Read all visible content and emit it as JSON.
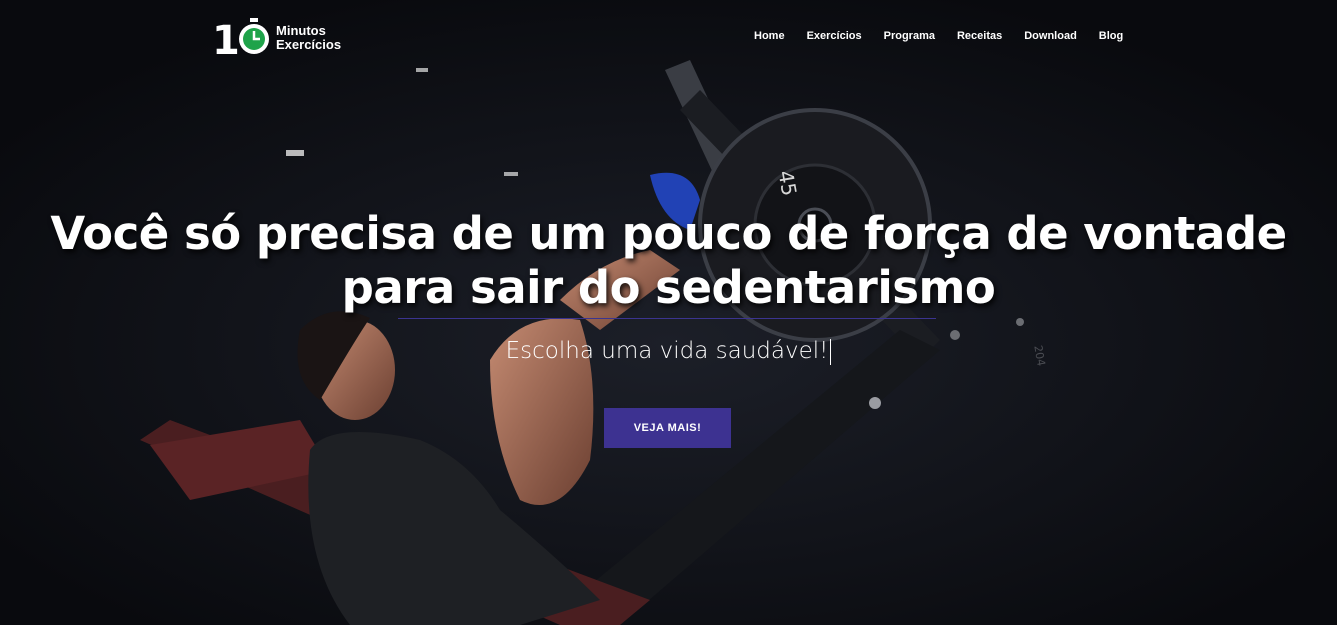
{
  "brand": {
    "logo_number": "10",
    "line1": "Minutos",
    "line2": "Exercícios",
    "accent_color": "#1fa34a"
  },
  "nav": {
    "items": [
      "Home",
      "Exercícios",
      "Programa",
      "Receitas",
      "Download",
      "Blog"
    ]
  },
  "hero": {
    "headline": "Você só precisa de um pouco de força de vontade para sair do sedentarismo",
    "subtitle": "Escolha uma vida saudável!",
    "cta_label": "VEJA MAIS!",
    "cta_color": "#3d3291",
    "divider_color": "#3b3490"
  }
}
